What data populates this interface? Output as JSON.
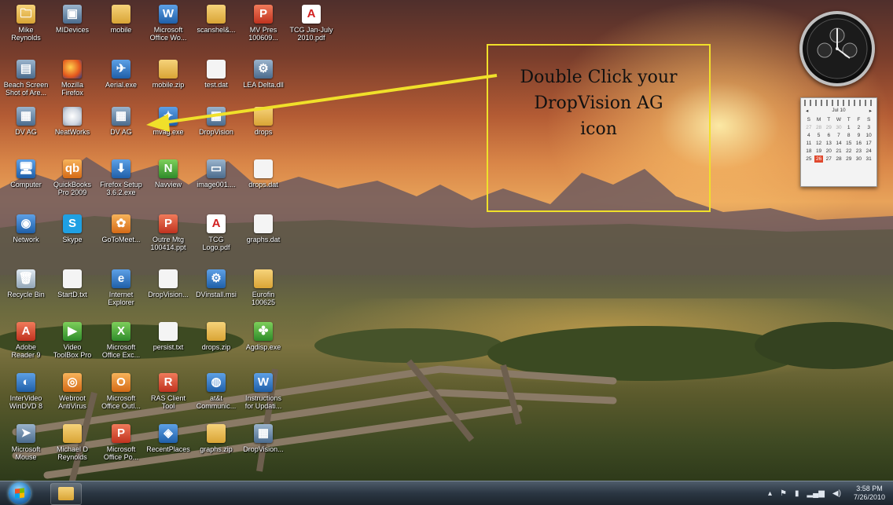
{
  "desktop": {
    "icons": [
      {
        "label": "Mike\nReynolds",
        "icon": "folder-icon",
        "glyph": "🗀"
      },
      {
        "label": "MIDevices",
        "icon": "devices-icon",
        "glyph": "▣"
      },
      {
        "label": "mobile",
        "icon": "folder-icon",
        "glyph": ""
      },
      {
        "label": "Microsoft\nOffice Wo...",
        "icon": "word-icon",
        "glyph": "W"
      },
      {
        "label": "scanshel&...",
        "icon": "folder-icon",
        "glyph": ""
      },
      {
        "label": "MV Pres\n100609...",
        "icon": "powerpoint-icon",
        "glyph": "P"
      },
      {
        "label": "TCG Jan-July\n2010.pdf",
        "icon": "pdf-icon",
        "glyph": "A"
      },
      {
        "label": "Beach Screen\nShot of Are...",
        "icon": "image-icon",
        "glyph": "▤"
      },
      {
        "label": "Mozilla\nFirefox",
        "icon": "firefox-icon",
        "glyph": ""
      },
      {
        "label": "Aerial.exe",
        "icon": "app-icon",
        "glyph": "✈"
      },
      {
        "label": "mobile.zip",
        "icon": "zip-icon",
        "glyph": ""
      },
      {
        "label": "test.dat",
        "icon": "file-icon",
        "glyph": ""
      },
      {
        "label": "LEA Delta.dll",
        "icon": "dll-icon",
        "glyph": "⚙"
      },
      {
        "label": "DV AG",
        "icon": "dropvision-icon",
        "glyph": "▦"
      },
      {
        "label": "NeatWorks",
        "icon": "disc-icon",
        "glyph": ""
      },
      {
        "label": "DV AG",
        "icon": "dropvision-icon",
        "glyph": "▦"
      },
      {
        "label": "mvag.exe",
        "icon": "app-icon",
        "glyph": "✦"
      },
      {
        "label": "DropVision",
        "icon": "dropvision-icon",
        "glyph": "▦"
      },
      {
        "label": "drops",
        "icon": "folder-icon",
        "glyph": ""
      },
      {
        "label": "Computer",
        "icon": "computer-icon",
        "glyph": "🖥"
      },
      {
        "label": "QuickBooks\nPro 2009",
        "icon": "quickbooks-icon",
        "glyph": "qb"
      },
      {
        "label": "Firefox Setup\n3.6.2.exe",
        "icon": "installer-icon",
        "glyph": "⬇"
      },
      {
        "label": "Navview",
        "icon": "navview-icon",
        "glyph": "N"
      },
      {
        "label": "image001....",
        "icon": "image-icon",
        "glyph": "▭"
      },
      {
        "label": "drops.dat",
        "icon": "file-icon",
        "glyph": ""
      },
      {
        "label": "Network",
        "icon": "network-icon",
        "glyph": "◉"
      },
      {
        "label": "Skype",
        "icon": "skype-icon",
        "glyph": "S"
      },
      {
        "label": "GoToMeet...",
        "icon": "gotomeeting-icon",
        "glyph": "✿"
      },
      {
        "label": "Outre Mtg\n100414.ppt",
        "icon": "powerpoint-icon",
        "glyph": "P"
      },
      {
        "label": "TCG\nLogo.pdf",
        "icon": "pdf-icon",
        "glyph": "A"
      },
      {
        "label": "graphs.dat",
        "icon": "file-icon",
        "glyph": ""
      },
      {
        "label": "Recycle Bin",
        "icon": "recycle-bin-icon",
        "glyph": "🗑"
      },
      {
        "label": "StartD.txt",
        "icon": "text-file-icon",
        "glyph": ""
      },
      {
        "label": "Internet\nExplorer",
        "icon": "ie-icon",
        "glyph": "e"
      },
      {
        "label": "DropVision...",
        "icon": "file-icon",
        "glyph": ""
      },
      {
        "label": "DVinstall.msi",
        "icon": "msi-icon",
        "glyph": "⚙"
      },
      {
        "label": "Eurofin\n100625",
        "icon": "folder-icon",
        "glyph": ""
      },
      {
        "label": "Adobe\nReader 9",
        "icon": "adobe-reader-icon",
        "glyph": "A"
      },
      {
        "label": "Video\nToolBox Pro",
        "icon": "video-toolbox-icon",
        "glyph": "▶"
      },
      {
        "label": "Microsoft\nOffice Exc...",
        "icon": "excel-icon",
        "glyph": "X"
      },
      {
        "label": "persist.txt",
        "icon": "text-file-icon",
        "glyph": ""
      },
      {
        "label": "drops.zip",
        "icon": "zip-icon",
        "glyph": ""
      },
      {
        "label": "Agdisp.exe",
        "icon": "agdisp-icon",
        "glyph": "✤"
      },
      {
        "label": "InterVideo\nWinDVD 8",
        "icon": "windvd-icon",
        "glyph": "◐"
      },
      {
        "label": "Webroot\nAntiVirus",
        "icon": "webroot-icon",
        "glyph": "◎"
      },
      {
        "label": "Microsoft\nOffice Outl...",
        "icon": "outlook-icon",
        "glyph": "O"
      },
      {
        "label": "RAS Client\nTool",
        "icon": "ras-client-icon",
        "glyph": "R"
      },
      {
        "label": "at&t\nCommunic...",
        "icon": "att-icon",
        "glyph": "◍"
      },
      {
        "label": "Instructions\nfor Updati...",
        "icon": "document-icon",
        "glyph": "W"
      },
      {
        "label": "Microsoft\nMouse",
        "icon": "mouse-icon",
        "glyph": "➤"
      },
      {
        "label": "Michael D\nReynolds",
        "icon": "folder-icon",
        "glyph": ""
      },
      {
        "label": "Microsoft\nOffice Po...",
        "icon": "powerpoint-icon",
        "glyph": "P"
      },
      {
        "label": "RecentPlaces",
        "icon": "recent-places-icon",
        "glyph": "◈"
      },
      {
        "label": "graphs.zip",
        "icon": "zip-icon",
        "glyph": ""
      },
      {
        "label": "DropVision...",
        "icon": "dropvision-icon",
        "glyph": "▦"
      }
    ]
  },
  "callout": {
    "text": "Double Click your\nDropVision AG\nicon",
    "border_color": "#f0e02a",
    "arrow_color": "#f0e02a"
  },
  "calendar": {
    "month": "Jul 10",
    "weekdays": [
      "S",
      "M",
      "T",
      "W",
      "T",
      "F",
      "S"
    ],
    "days": [
      "27",
      "28",
      "29",
      "30",
      "1",
      "2",
      "3",
      "4",
      "5",
      "6",
      "7",
      "8",
      "9",
      "10",
      "11",
      "12",
      "13",
      "14",
      "15",
      "16",
      "17",
      "18",
      "19",
      "20",
      "21",
      "22",
      "23",
      "24",
      "25",
      "26",
      "27",
      "28",
      "29",
      "30",
      "31"
    ],
    "today": "26"
  },
  "taskbar": {
    "time": "3:58 PM",
    "date": "7/26/2010"
  }
}
